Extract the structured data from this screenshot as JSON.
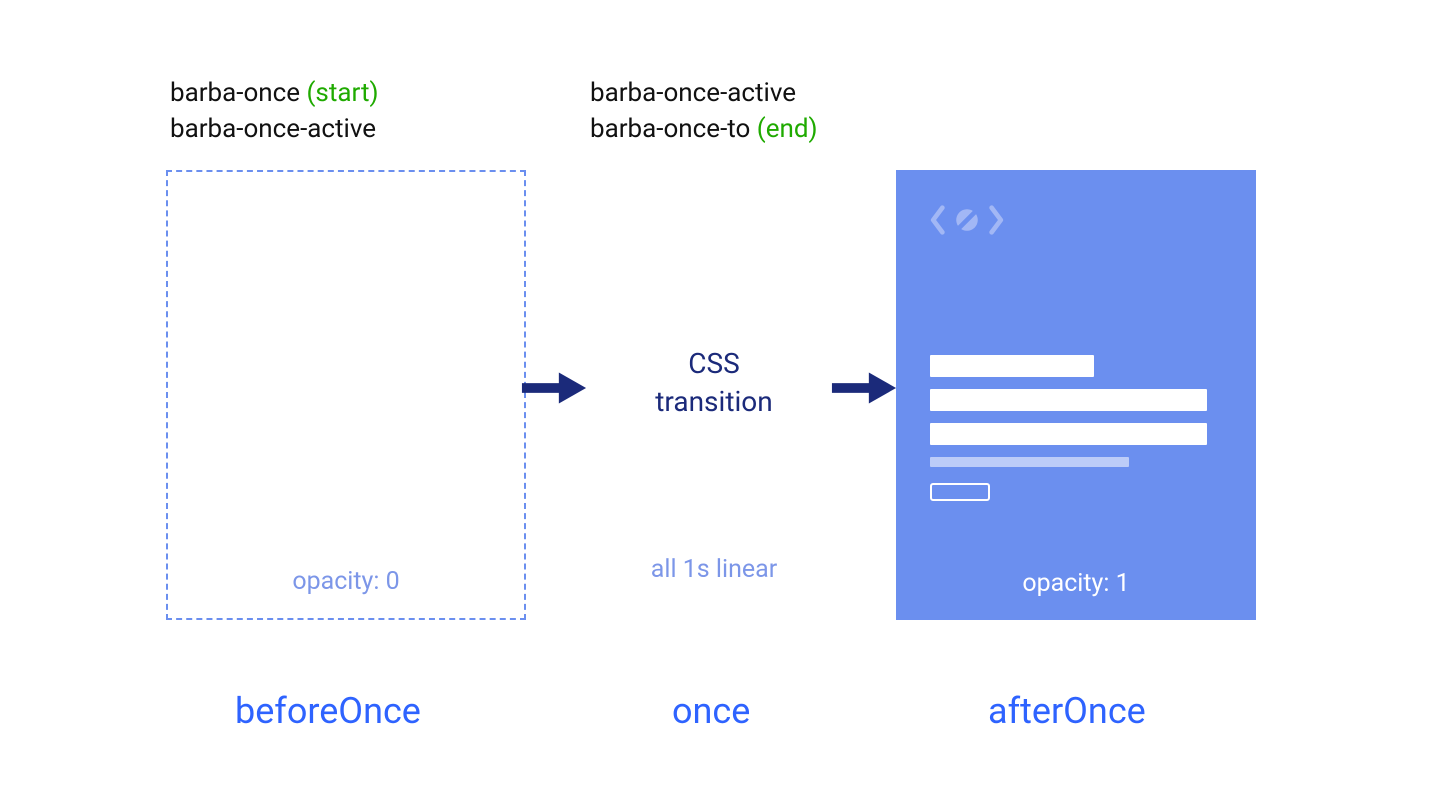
{
  "left": {
    "class1": "barba-once",
    "class1_note": "(start)",
    "class2": "barba-once-active",
    "opacity": "opacity: 0",
    "phase": "beforeOnce"
  },
  "mid": {
    "class1": "barba-once-active",
    "class2": "barba-once-to",
    "class2_note": "(end)",
    "title_line1": "CSS",
    "title_line2": "transition",
    "transition": "all 1s linear",
    "phase": "once"
  },
  "right": {
    "opacity": "opacity: 1",
    "phase": "afterOnce"
  }
}
